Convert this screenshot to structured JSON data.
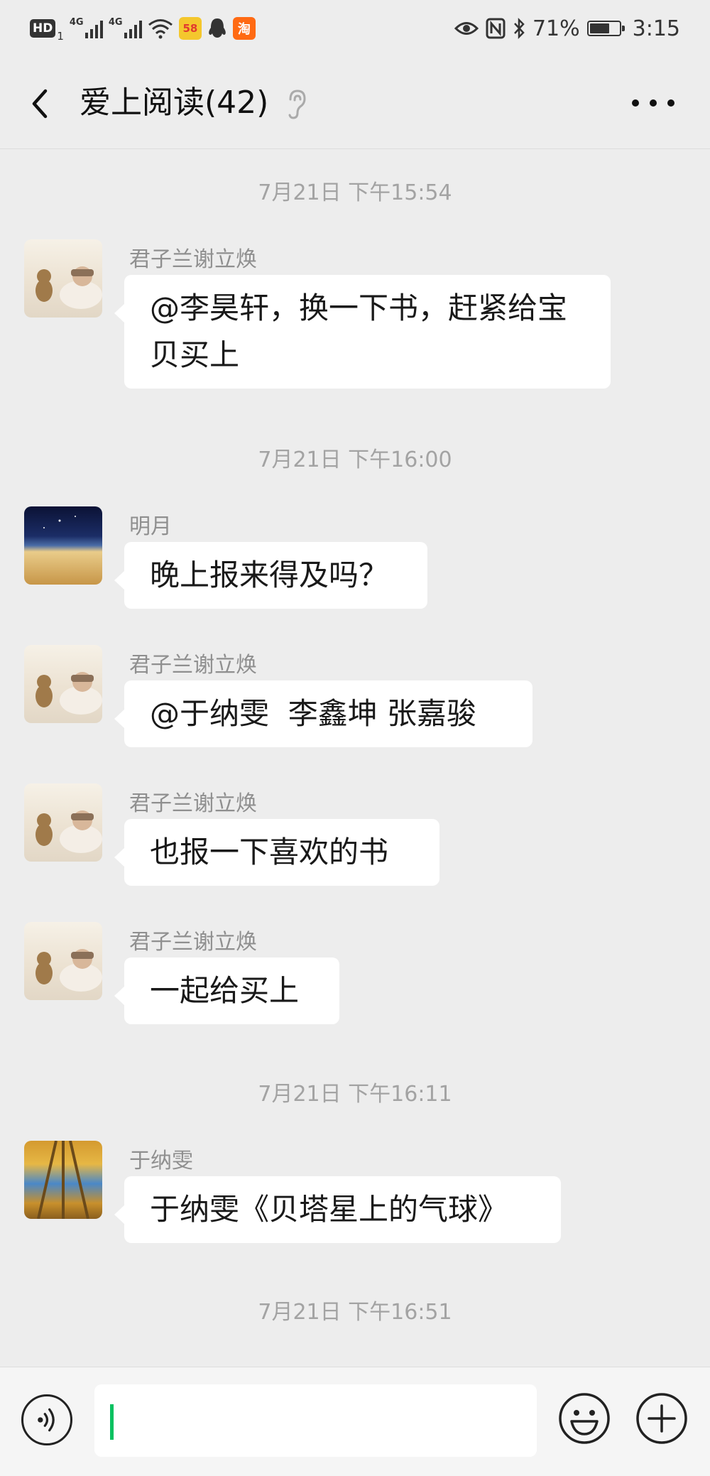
{
  "status_bar": {
    "hd_label": "HD",
    "sim_label": "1",
    "net1_label": "4G",
    "net2_label": "4G",
    "app1_label": "58",
    "app2_label": "淘",
    "battery_pct": "71%",
    "battery_level": 0.71,
    "time": "3:15"
  },
  "header": {
    "title": "爱上阅读(42)"
  },
  "messages": [
    {
      "type": "time",
      "text": "7月21日 下午15:54"
    },
    {
      "type": "msg",
      "sender": "君子兰谢立焕",
      "avatar": "baby-photo-avatar",
      "text": "@李昊轩，换一下书，赶紧给宝贝买上"
    },
    {
      "type": "time",
      "text": "7月21日 下午16:00"
    },
    {
      "type": "msg",
      "sender": "明月",
      "avatar": "night-sky-avatar",
      "text": "晚上报来得及吗？"
    },
    {
      "type": "msg",
      "sender": "君子兰谢立焕",
      "avatar": "baby-photo-avatar",
      "text": "@于纳雯  李鑫坤 张嘉骏"
    },
    {
      "type": "msg",
      "sender": "君子兰谢立焕",
      "avatar": "baby-photo-avatar",
      "text": "也报一下喜欢的书"
    },
    {
      "type": "msg",
      "sender": "君子兰谢立焕",
      "avatar": "baby-photo-avatar",
      "text": "一起给买上"
    },
    {
      "type": "time",
      "text": "7月21日 下午16:11"
    },
    {
      "type": "msg",
      "sender": "于纳雯",
      "avatar": "autumn-trees-avatar",
      "text": "于纳雯《贝塔星上的气球》"
    },
    {
      "type": "time",
      "text": "7月21日 下午16:51"
    }
  ],
  "input_bar": {
    "value": ""
  },
  "colors": {
    "background": "#ededed",
    "bubble": "#ffffff",
    "caret": "#07c160",
    "timestamp": "#a3a3a3"
  }
}
